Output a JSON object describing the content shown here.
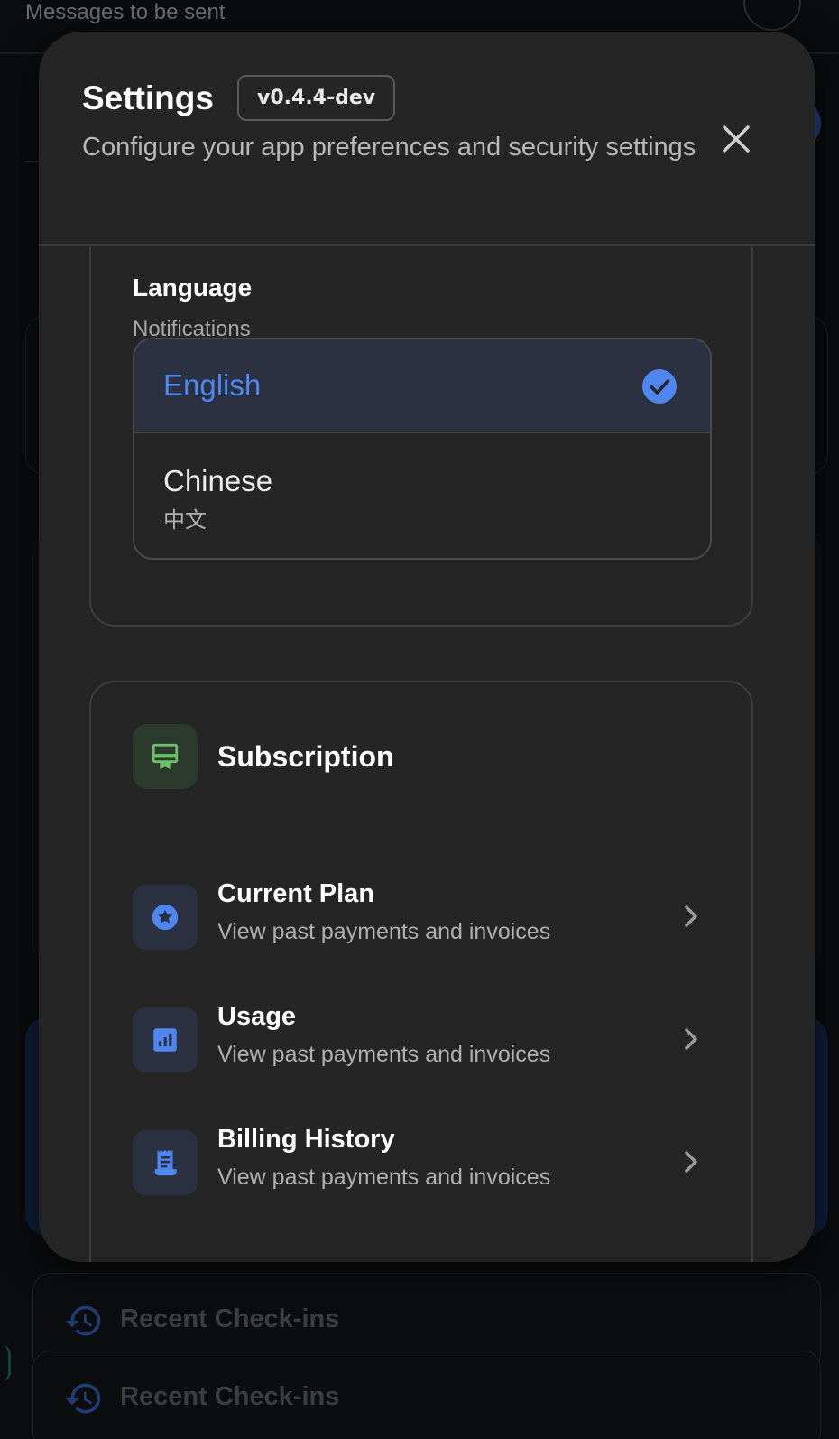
{
  "background": {
    "top_text": "Messages to be sent",
    "recent_cards": [
      {
        "label": "Recent Check-ins"
      },
      {
        "label": "Recent Check-ins"
      }
    ]
  },
  "modal": {
    "title": "Settings",
    "version": "v0.4.4-dev",
    "subtitle": "Configure your app preferences and security settings",
    "close_icon": "close-icon"
  },
  "language": {
    "title": "Language",
    "subtitle": "Notifications",
    "options": [
      {
        "name": "English",
        "native": "",
        "selected": true
      },
      {
        "name": "Chinese",
        "native": "中文",
        "selected": false
      }
    ]
  },
  "subscription": {
    "title": "Subscription",
    "icon": "card-membership-icon",
    "items": [
      {
        "name": "Current Plan",
        "description": "View past payments and invoices",
        "icon": "star-badge-icon"
      },
      {
        "name": "Usage",
        "description": "View past payments and invoices",
        "icon": "bar-chart-icon"
      },
      {
        "name": "Billing History",
        "description": "View past payments and invoices",
        "icon": "receipt-icon"
      }
    ]
  },
  "colors": {
    "accent": "#4f86f0",
    "green": "#6cc068",
    "modal_bg": "#252525"
  }
}
